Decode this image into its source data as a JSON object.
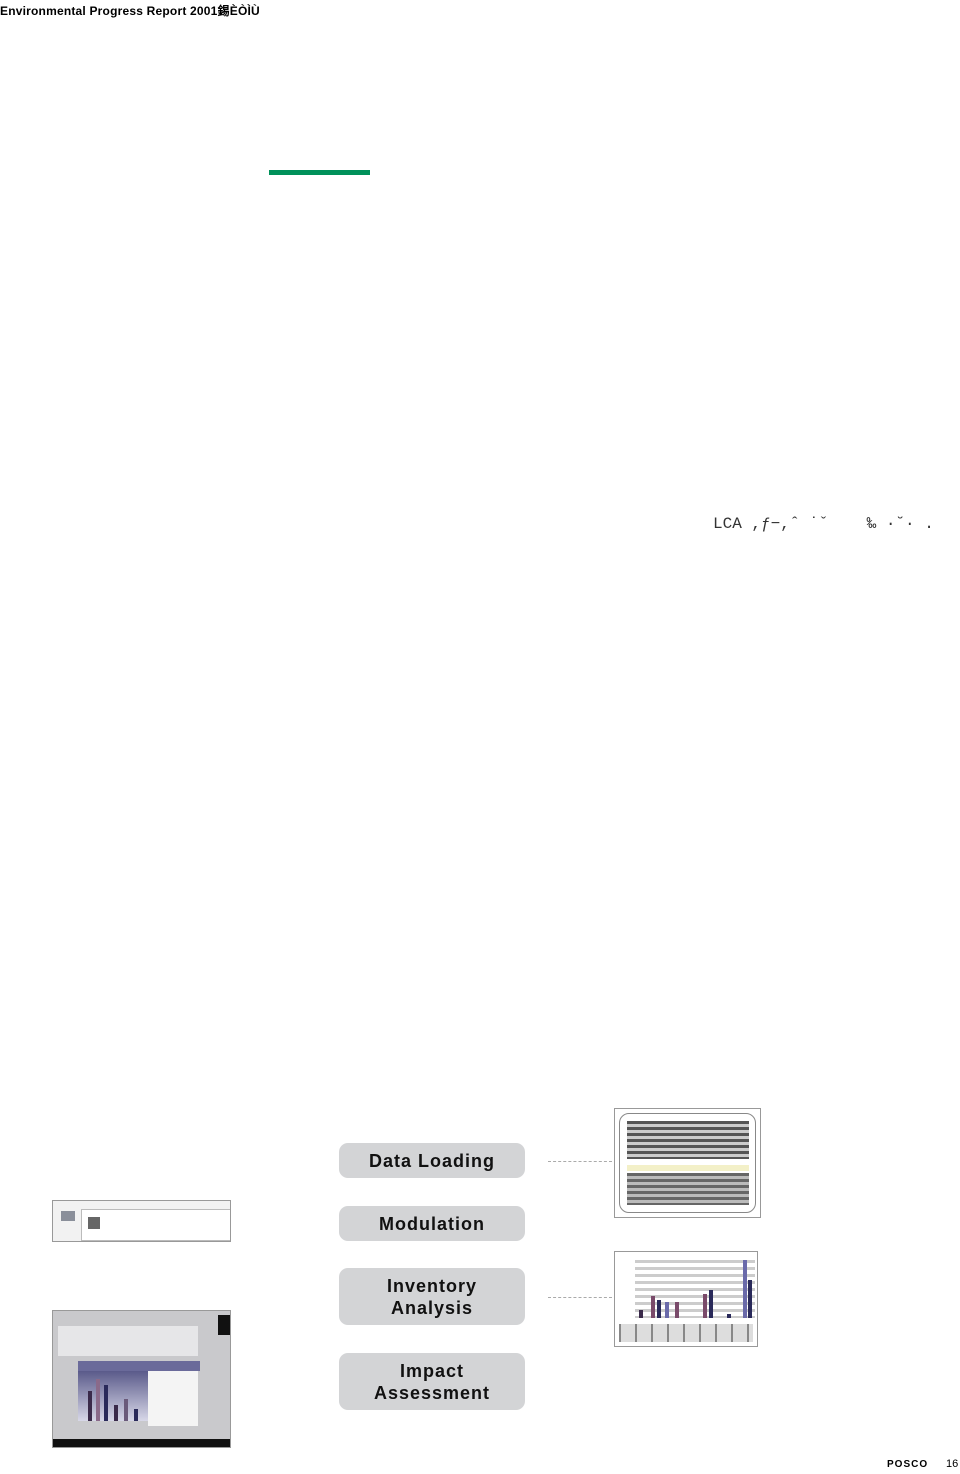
{
  "header": {
    "title": "Environmental Progress Report 2001",
    "garbled_suffix": "錫ÈÒÌÙ"
  },
  "accent_color": "#00915a",
  "body_text": "LCA ,ƒ−,ˆ ˙ˇ    ‰ ·˘· .",
  "process_steps": [
    {
      "label": "Data Loading"
    },
    {
      "label": "Modulation"
    },
    {
      "label": "Inventory\nAnalysis"
    },
    {
      "label": "Impact\nAssessment"
    }
  ],
  "footer": {
    "brand": "POSCO",
    "page_number": "16"
  }
}
